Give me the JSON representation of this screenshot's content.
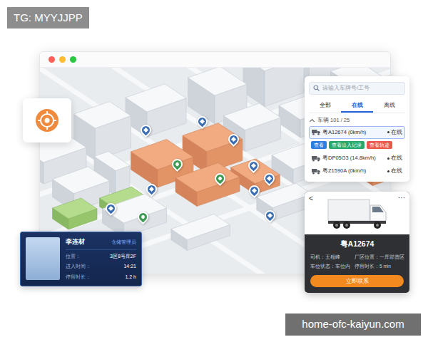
{
  "watermark_top": "TG: MYYJJPP",
  "watermark_bottom": "home-ofc-kaiyun.com",
  "window": {
    "dots": [
      {
        "color": "#ff5f57"
      },
      {
        "color": "#febc2e"
      },
      {
        "color": "#28c840"
      }
    ]
  },
  "map": {
    "pins": [
      {
        "kind": "vehicle",
        "color": "#3b6db3"
      },
      {
        "kind": "vehicle",
        "color": "#3b6db3"
      },
      {
        "kind": "vehicle",
        "color": "#3b6db3"
      },
      {
        "kind": "vehicle",
        "color": "#3b6db3"
      },
      {
        "kind": "vehicle",
        "color": "#3b6db3"
      },
      {
        "kind": "vehicle",
        "color": "#3b6db3"
      },
      {
        "kind": "person",
        "color": "#3c9a52"
      },
      {
        "kind": "person",
        "color": "#3c9a52"
      },
      {
        "kind": "person",
        "color": "#3c9a52"
      },
      {
        "kind": "vehicle",
        "color": "#3b6db3"
      },
      {
        "kind": "vehicle",
        "color": "#3b6db3"
      },
      {
        "kind": "vehicle",
        "color": "#3b6db3"
      }
    ]
  },
  "vehicle_panel": {
    "search": {
      "placeholder": "请输入车牌号/工号"
    },
    "tabs": [
      {
        "label": "全部",
        "selected": false
      },
      {
        "label": "在线",
        "selected": true
      },
      {
        "label": "离线",
        "selected": false
      }
    ],
    "group": {
      "label": "车辆 101 / 25",
      "expanded": true
    },
    "vehicles": [
      {
        "label": "粤A12674 (0km/h)",
        "status": "在线",
        "selected": true,
        "actions": [
          {
            "label": "查看",
            "color": "#2f7de1"
          },
          {
            "label": "查看出入记录",
            "color": "#27a86b"
          },
          {
            "label": "查看轨迹",
            "color": "#e8574a"
          }
        ]
      },
      {
        "label": "粤DP05G3 (14.8km/h)",
        "status": "在线",
        "selected": false,
        "actions": []
      },
      {
        "label": "粤Z1590A (0km/h)",
        "status": "在线",
        "selected": false,
        "actions": []
      }
    ]
  },
  "vehicle_card": {
    "back": "<",
    "more": "···",
    "plate": "粤A12674",
    "fields": [
      {
        "label": "司机：",
        "value": "王程峰"
      },
      {
        "label": "厂区位置：",
        "value": "一库部货区"
      },
      {
        "label": "车位状态：",
        "value": "车位内"
      },
      {
        "label": "停留时长：",
        "value": "5 min"
      }
    ],
    "button": "立即联系"
  },
  "person_card": {
    "name": "李连材",
    "role": "仓储管理员",
    "fields": [
      {
        "label": "位置：",
        "value": "3区8号库2F"
      },
      {
        "label": "进入时间：",
        "value": "14:21"
      },
      {
        "label": "停留时长：",
        "value": "1.2 h"
      }
    ]
  }
}
